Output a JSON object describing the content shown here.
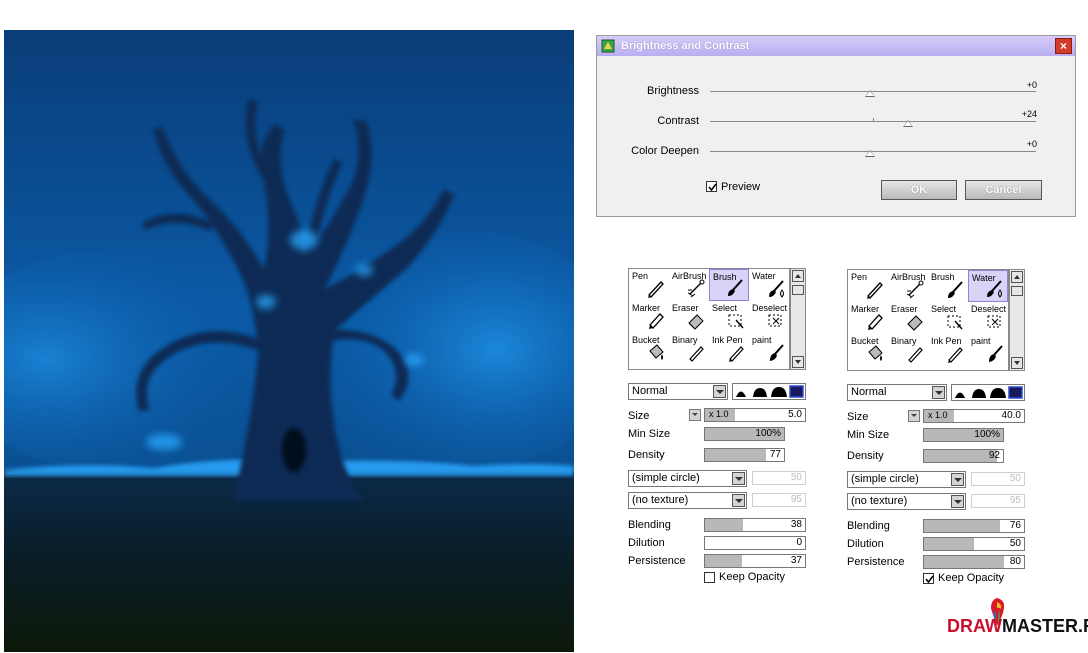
{
  "dialog": {
    "title": "Brightness and Contrast",
    "close_label": "×",
    "sliders": [
      {
        "label": "Brightness",
        "value_text": "+0",
        "value": 0
      },
      {
        "label": "Contrast",
        "value_text": "+24",
        "value": 24
      },
      {
        "label": "Color Deepen",
        "value_text": "+0",
        "value": 0
      }
    ],
    "preview_label": "Preview",
    "preview_checked": true,
    "ok_label": "OK",
    "cancel_label": "Cancel"
  },
  "panels": [
    {
      "tools": [
        {
          "label": "Pen",
          "icon": "pen-icon"
        },
        {
          "label": "AirBrush",
          "icon": "airbrush-icon"
        },
        {
          "label": "Brush",
          "icon": "brush-icon",
          "selected": true
        },
        {
          "label": "Water",
          "icon": "water-icon"
        },
        {
          "label": "Marker",
          "icon": "marker-icon"
        },
        {
          "label": "Eraser",
          "icon": "eraser-icon"
        },
        {
          "label": "Select",
          "icon": "select-icon"
        },
        {
          "label": "Deselect",
          "icon": "deselect-icon"
        },
        {
          "label": "Bucket",
          "icon": "bucket-icon"
        },
        {
          "label": "Binary",
          "icon": "binary-icon"
        },
        {
          "label": "Ink Pen",
          "icon": "ink-pen-icon"
        },
        {
          "label": "paint",
          "icon": "paint-icon"
        }
      ],
      "blend_mode": "Normal",
      "size_multiplier": "x 1.0",
      "size_value": "5.0",
      "size_label": "Size",
      "min_size_label": "Min Size",
      "min_size": "100%",
      "min_size_fraction": 1.0,
      "density_label": "Density",
      "density": "77",
      "density_fraction": 0.77,
      "shape": "(simple circle)",
      "shape_value": "50",
      "texture": "(no texture)",
      "texture_value": "95",
      "blending_label": "Blending",
      "blending": "38",
      "blending_fraction": 0.38,
      "dilution_label": "Dilution",
      "dilution": "0",
      "dilution_fraction": 0.0,
      "persistence_label": "Persistence",
      "persistence": "37",
      "persistence_fraction": 0.37,
      "keep_opacity_label": "Keep Opacity",
      "keep_opacity": false
    },
    {
      "tools": [
        {
          "label": "Pen",
          "icon": "pen-icon"
        },
        {
          "label": "AirBrush",
          "icon": "airbrush-icon"
        },
        {
          "label": "Brush",
          "icon": "brush-icon"
        },
        {
          "label": "Water",
          "icon": "water-icon",
          "selected": true
        },
        {
          "label": "Marker",
          "icon": "marker-icon"
        },
        {
          "label": "Eraser",
          "icon": "eraser-icon"
        },
        {
          "label": "Select",
          "icon": "select-icon"
        },
        {
          "label": "Deselect",
          "icon": "deselect-icon"
        },
        {
          "label": "Bucket",
          "icon": "bucket-icon"
        },
        {
          "label": "Binary",
          "icon": "binary-icon"
        },
        {
          "label": "Ink Pen",
          "icon": "ink-pen-icon"
        },
        {
          "label": "paint",
          "icon": "paint-icon"
        }
      ],
      "blend_mode": "Normal",
      "size_multiplier": "x 1.0",
      "size_value": "40.0",
      "size_label": "Size",
      "min_size_label": "Min Size",
      "min_size": "100%",
      "min_size_fraction": 1.0,
      "density_label": "Density",
      "density": "92",
      "density_fraction": 0.92,
      "shape": "(simple circle)",
      "shape_value": "50",
      "texture": "(no texture)",
      "texture_value": "95",
      "blending_label": "Blending",
      "blending": "76",
      "blending_fraction": 0.76,
      "dilution_label": "Dilution",
      "dilution": "50",
      "dilution_fraction": 0.5,
      "persistence_label": "Persistence",
      "persistence": "80",
      "persistence_fraction": 0.8,
      "keep_opacity_label": "Keep Opacity",
      "keep_opacity": true
    }
  ],
  "logo": {
    "text_left": "DRAW",
    "text_right": "MASTER.RU"
  },
  "colors": {
    "accent_selected": "#d8d4f8",
    "sky": "#0c4f92",
    "glow": "#2aa8ff",
    "logo_red": "#c8102e"
  }
}
